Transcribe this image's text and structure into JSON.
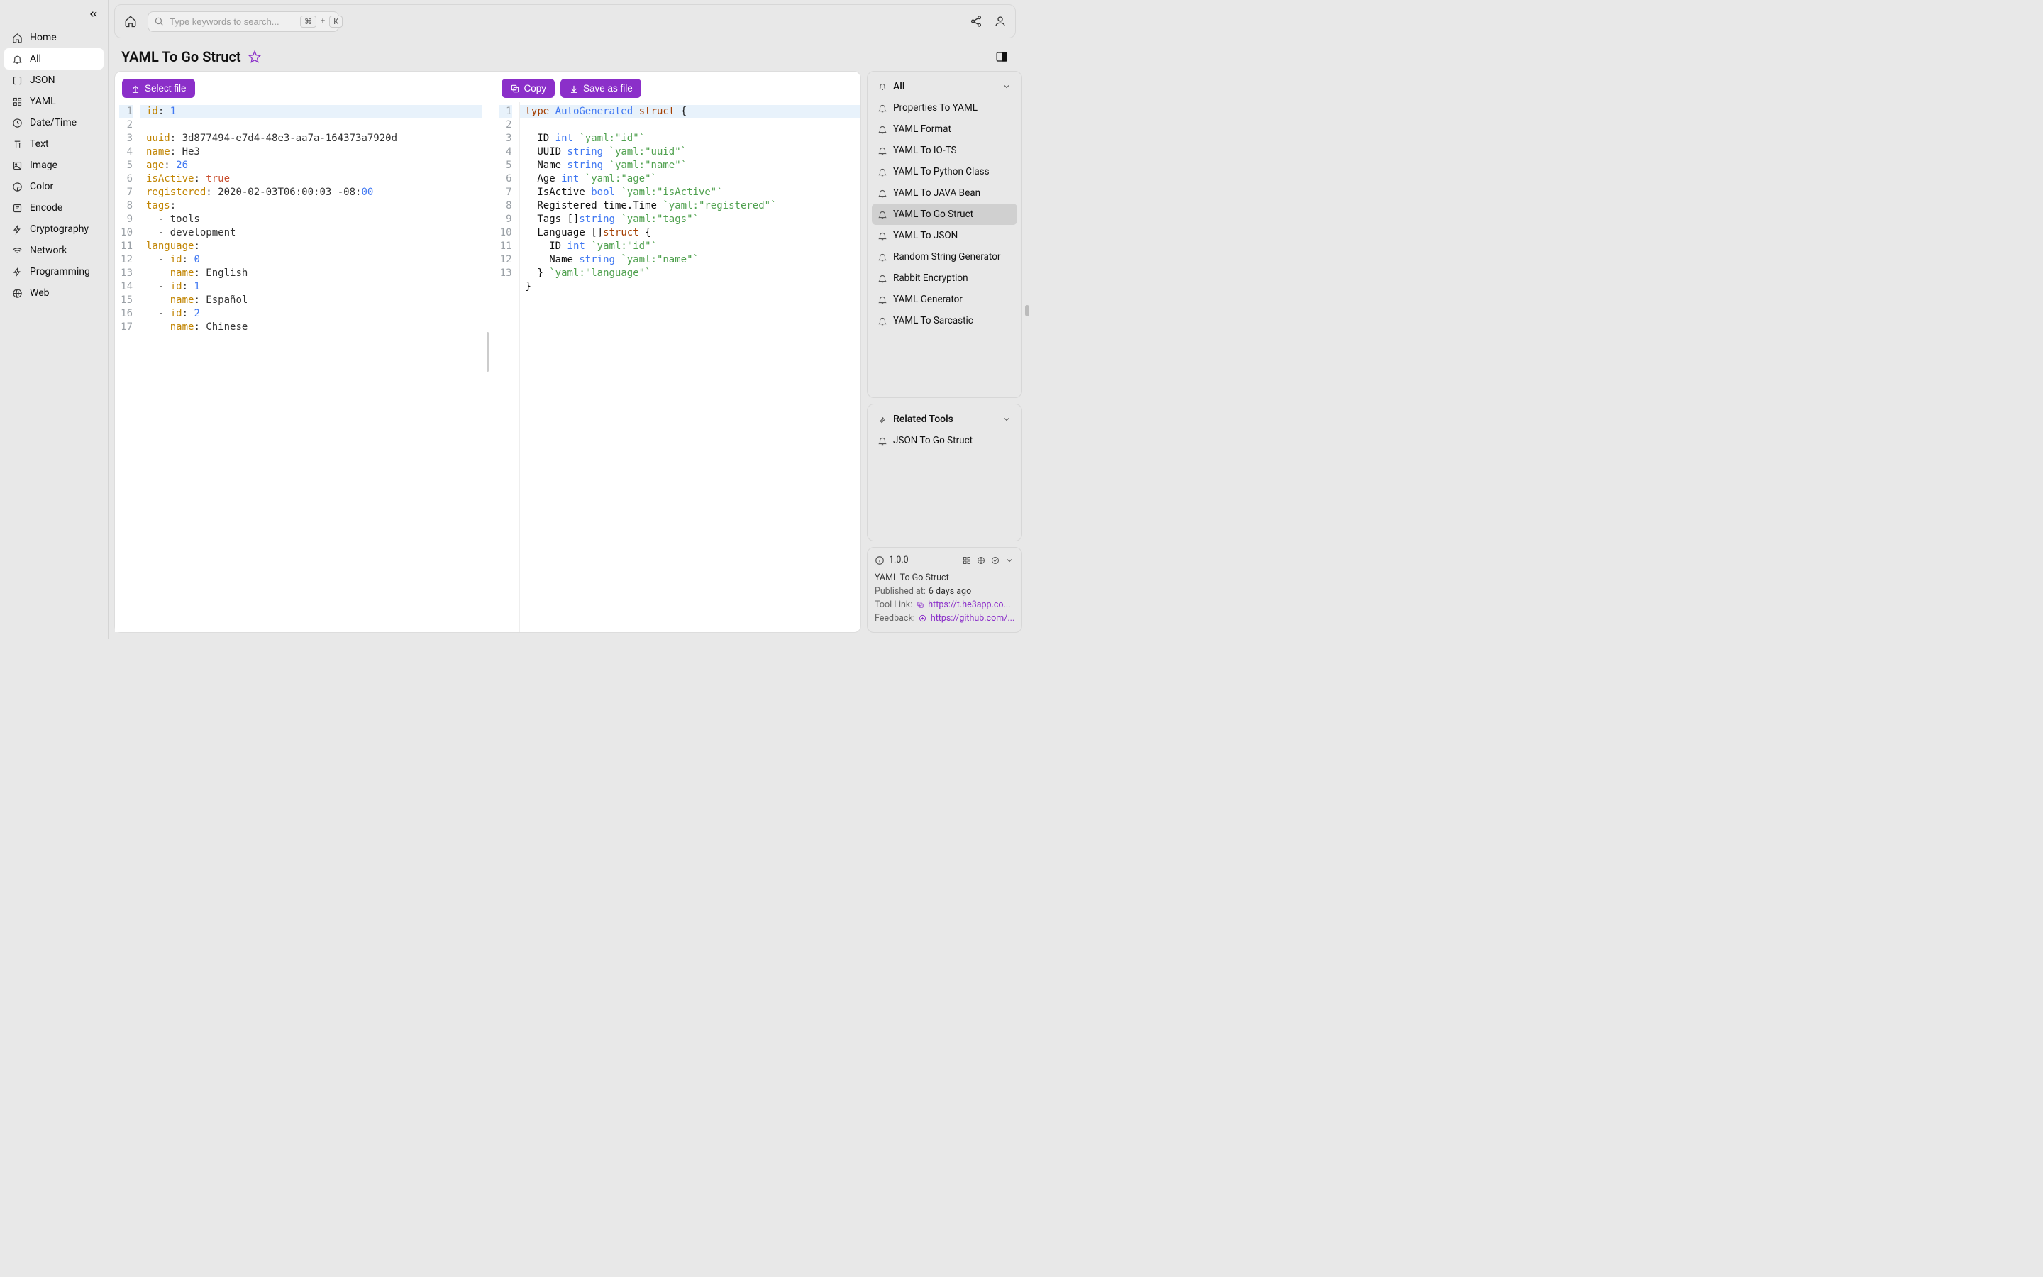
{
  "sidebar": {
    "items": [
      {
        "label": "Home",
        "icon": "home-icon"
      },
      {
        "label": "All",
        "icon": "bell-icon",
        "active": true
      },
      {
        "label": "JSON",
        "icon": "brackets-icon"
      },
      {
        "label": "YAML",
        "icon": "grid-icon"
      },
      {
        "label": "Date/Time",
        "icon": "clock-icon"
      },
      {
        "label": "Text",
        "icon": "text-icon"
      },
      {
        "label": "Image",
        "icon": "image-icon"
      },
      {
        "label": "Color",
        "icon": "palette-icon"
      },
      {
        "label": "Encode",
        "icon": "encode-icon"
      },
      {
        "label": "Cryptography",
        "icon": "bolt-icon"
      },
      {
        "label": "Network",
        "icon": "wifi-icon"
      },
      {
        "label": "Programming",
        "icon": "code-icon"
      },
      {
        "label": "Web",
        "icon": "globe-icon"
      }
    ]
  },
  "search": {
    "placeholder": "Type keywords to search...",
    "kbd1": "⌘",
    "kbd_plus": "+",
    "kbd2": "K"
  },
  "page": {
    "title": "YAML To Go Struct"
  },
  "buttons": {
    "select_file": "Select file",
    "copy": "Copy",
    "save_as_file": "Save as file"
  },
  "code_input": {
    "line_count": 17,
    "lines": [
      {
        "n": 1,
        "tokens": [
          {
            "t": "id",
            "c": "c-key"
          },
          {
            "t": ": ",
            "c": "c-punc"
          },
          {
            "t": "1",
            "c": "c-num"
          }
        ]
      },
      {
        "n": 2,
        "tokens": [
          {
            "t": "uuid",
            "c": "c-key"
          },
          {
            "t": ": ",
            "c": "c-punc"
          },
          {
            "t": "3d877494-e7d4-48e3-aa7a-164373a7920d",
            "c": "c-str"
          }
        ]
      },
      {
        "n": 3,
        "tokens": [
          {
            "t": "name",
            "c": "c-key"
          },
          {
            "t": ": ",
            "c": "c-punc"
          },
          {
            "t": "He3",
            "c": "c-str"
          }
        ]
      },
      {
        "n": 4,
        "tokens": [
          {
            "t": "age",
            "c": "c-key"
          },
          {
            "t": ": ",
            "c": "c-punc"
          },
          {
            "t": "26",
            "c": "c-num"
          }
        ]
      },
      {
        "n": 5,
        "tokens": [
          {
            "t": "isActive",
            "c": "c-key"
          },
          {
            "t": ": ",
            "c": "c-punc"
          },
          {
            "t": "true",
            "c": "c-bool"
          }
        ]
      },
      {
        "n": 6,
        "tokens": [
          {
            "t": "registered",
            "c": "c-key"
          },
          {
            "t": ": ",
            "c": "c-punc"
          },
          {
            "t": "2020-02-03T06:00:03 -08:",
            "c": "c-date"
          },
          {
            "t": "00",
            "c": "c-num"
          }
        ]
      },
      {
        "n": 7,
        "tokens": [
          {
            "t": "tags",
            "c": "c-key"
          },
          {
            "t": ":",
            "c": "c-punc"
          }
        ]
      },
      {
        "n": 8,
        "tokens": [
          {
            "t": "  - ",
            "c": "c-dash"
          },
          {
            "t": "tools",
            "c": "c-str"
          }
        ]
      },
      {
        "n": 9,
        "tokens": [
          {
            "t": "  - ",
            "c": "c-dash"
          },
          {
            "t": "development",
            "c": "c-str"
          }
        ]
      },
      {
        "n": 10,
        "tokens": [
          {
            "t": "language",
            "c": "c-key"
          },
          {
            "t": ":",
            "c": "c-punc"
          }
        ]
      },
      {
        "n": 11,
        "tokens": [
          {
            "t": "  - ",
            "c": "c-dash"
          },
          {
            "t": "id",
            "c": "c-key"
          },
          {
            "t": ": ",
            "c": "c-punc"
          },
          {
            "t": "0",
            "c": "c-num"
          }
        ]
      },
      {
        "n": 12,
        "tokens": [
          {
            "t": "    ",
            "c": ""
          },
          {
            "t": "name",
            "c": "c-key"
          },
          {
            "t": ": ",
            "c": "c-punc"
          },
          {
            "t": "English",
            "c": "c-str"
          }
        ]
      },
      {
        "n": 13,
        "tokens": [
          {
            "t": "  - ",
            "c": "c-dash"
          },
          {
            "t": "id",
            "c": "c-key"
          },
          {
            "t": ": ",
            "c": "c-punc"
          },
          {
            "t": "1",
            "c": "c-num"
          }
        ]
      },
      {
        "n": 14,
        "tokens": [
          {
            "t": "    ",
            "c": ""
          },
          {
            "t": "name",
            "c": "c-key"
          },
          {
            "t": ": ",
            "c": "c-punc"
          },
          {
            "t": "Español",
            "c": "c-str"
          }
        ]
      },
      {
        "n": 15,
        "tokens": [
          {
            "t": "  - ",
            "c": "c-dash"
          },
          {
            "t": "id",
            "c": "c-key"
          },
          {
            "t": ": ",
            "c": "c-punc"
          },
          {
            "t": "2",
            "c": "c-num"
          }
        ]
      },
      {
        "n": 16,
        "tokens": [
          {
            "t": "    ",
            "c": ""
          },
          {
            "t": "name",
            "c": "c-key"
          },
          {
            "t": ": ",
            "c": "c-punc"
          },
          {
            "t": "Chinese",
            "c": "c-str"
          }
        ]
      },
      {
        "n": 17,
        "tokens": []
      }
    ]
  },
  "code_output": {
    "line_count": 13,
    "lines": [
      {
        "n": 1,
        "tokens": [
          {
            "t": "type ",
            "c": "g-kw"
          },
          {
            "t": "AutoGenerated ",
            "c": "g-id"
          },
          {
            "t": "struct",
            "c": "g-kw"
          },
          {
            "t": " {",
            "c": ""
          }
        ]
      },
      {
        "n": 2,
        "tokens": [
          {
            "t": "  ID ",
            "c": ""
          },
          {
            "t": "int",
            "c": "g-type"
          },
          {
            "t": " `yaml:\"id\"`",
            "c": "g-tag"
          }
        ]
      },
      {
        "n": 3,
        "tokens": [
          {
            "t": "  UUID ",
            "c": ""
          },
          {
            "t": "string",
            "c": "g-type"
          },
          {
            "t": " `yaml:\"uuid\"`",
            "c": "g-tag"
          }
        ]
      },
      {
        "n": 4,
        "tokens": [
          {
            "t": "  Name ",
            "c": ""
          },
          {
            "t": "string",
            "c": "g-type"
          },
          {
            "t": " `yaml:\"name\"`",
            "c": "g-tag"
          }
        ]
      },
      {
        "n": 5,
        "tokens": [
          {
            "t": "  Age ",
            "c": ""
          },
          {
            "t": "int",
            "c": "g-type"
          },
          {
            "t": " `yaml:\"age\"`",
            "c": "g-tag"
          }
        ]
      },
      {
        "n": 6,
        "tokens": [
          {
            "t": "  IsActive ",
            "c": ""
          },
          {
            "t": "bool",
            "c": "g-type"
          },
          {
            "t": " `yaml:\"isActive\"`",
            "c": "g-tag"
          }
        ]
      },
      {
        "n": 7,
        "tokens": [
          {
            "t": "  Registered ",
            "c": ""
          },
          {
            "t": "time.Time",
            "c": ""
          },
          {
            "t": " `yaml:\"registered\"`",
            "c": "g-tag"
          }
        ]
      },
      {
        "n": 8,
        "tokens": [
          {
            "t": "  Tags []",
            "c": ""
          },
          {
            "t": "string",
            "c": "g-type"
          },
          {
            "t": " `yaml:\"tags\"`",
            "c": "g-tag"
          }
        ]
      },
      {
        "n": 9,
        "tokens": [
          {
            "t": "  Language []",
            "c": ""
          },
          {
            "t": "struct",
            "c": "g-kw"
          },
          {
            "t": " {",
            "c": ""
          }
        ]
      },
      {
        "n": 10,
        "tokens": [
          {
            "t": "    ID ",
            "c": ""
          },
          {
            "t": "int",
            "c": "g-type"
          },
          {
            "t": " `yaml:\"id\"`",
            "c": "g-tag"
          }
        ]
      },
      {
        "n": 11,
        "tokens": [
          {
            "t": "    Name ",
            "c": ""
          },
          {
            "t": "string",
            "c": "g-type"
          },
          {
            "t": " `yaml:\"name\"`",
            "c": "g-tag"
          }
        ]
      },
      {
        "n": 12,
        "tokens": [
          {
            "t": "  } ",
            "c": ""
          },
          {
            "t": "`yaml:\"language\"`",
            "c": "g-tag"
          }
        ]
      },
      {
        "n": 13,
        "tokens": [
          {
            "t": "}",
            "c": ""
          }
        ]
      }
    ]
  },
  "right": {
    "all_header": "All",
    "items": [
      {
        "label": "Properties To YAML"
      },
      {
        "label": "YAML Format"
      },
      {
        "label": "YAML To IO-TS"
      },
      {
        "label": "YAML To Python Class"
      },
      {
        "label": "YAML To JAVA Bean"
      },
      {
        "label": "YAML To Go Struct",
        "active": true
      },
      {
        "label": "YAML To JSON"
      },
      {
        "label": "Random String Generator"
      },
      {
        "label": "Rabbit Encryption"
      },
      {
        "label": "YAML Generator"
      },
      {
        "label": "YAML To Sarcastic"
      }
    ],
    "related_header": "Related Tools",
    "related_items": [
      {
        "label": "JSON To Go Struct"
      }
    ]
  },
  "meta": {
    "version": "1.0.0",
    "name": "YAML To Go Struct",
    "published_label": "Published at:",
    "published_value": "6 days ago",
    "tool_link_label": "Tool Link:",
    "tool_link_value": "https://t.he3app.co...",
    "feedback_label": "Feedback:",
    "feedback_value": "https://github.com/..."
  }
}
